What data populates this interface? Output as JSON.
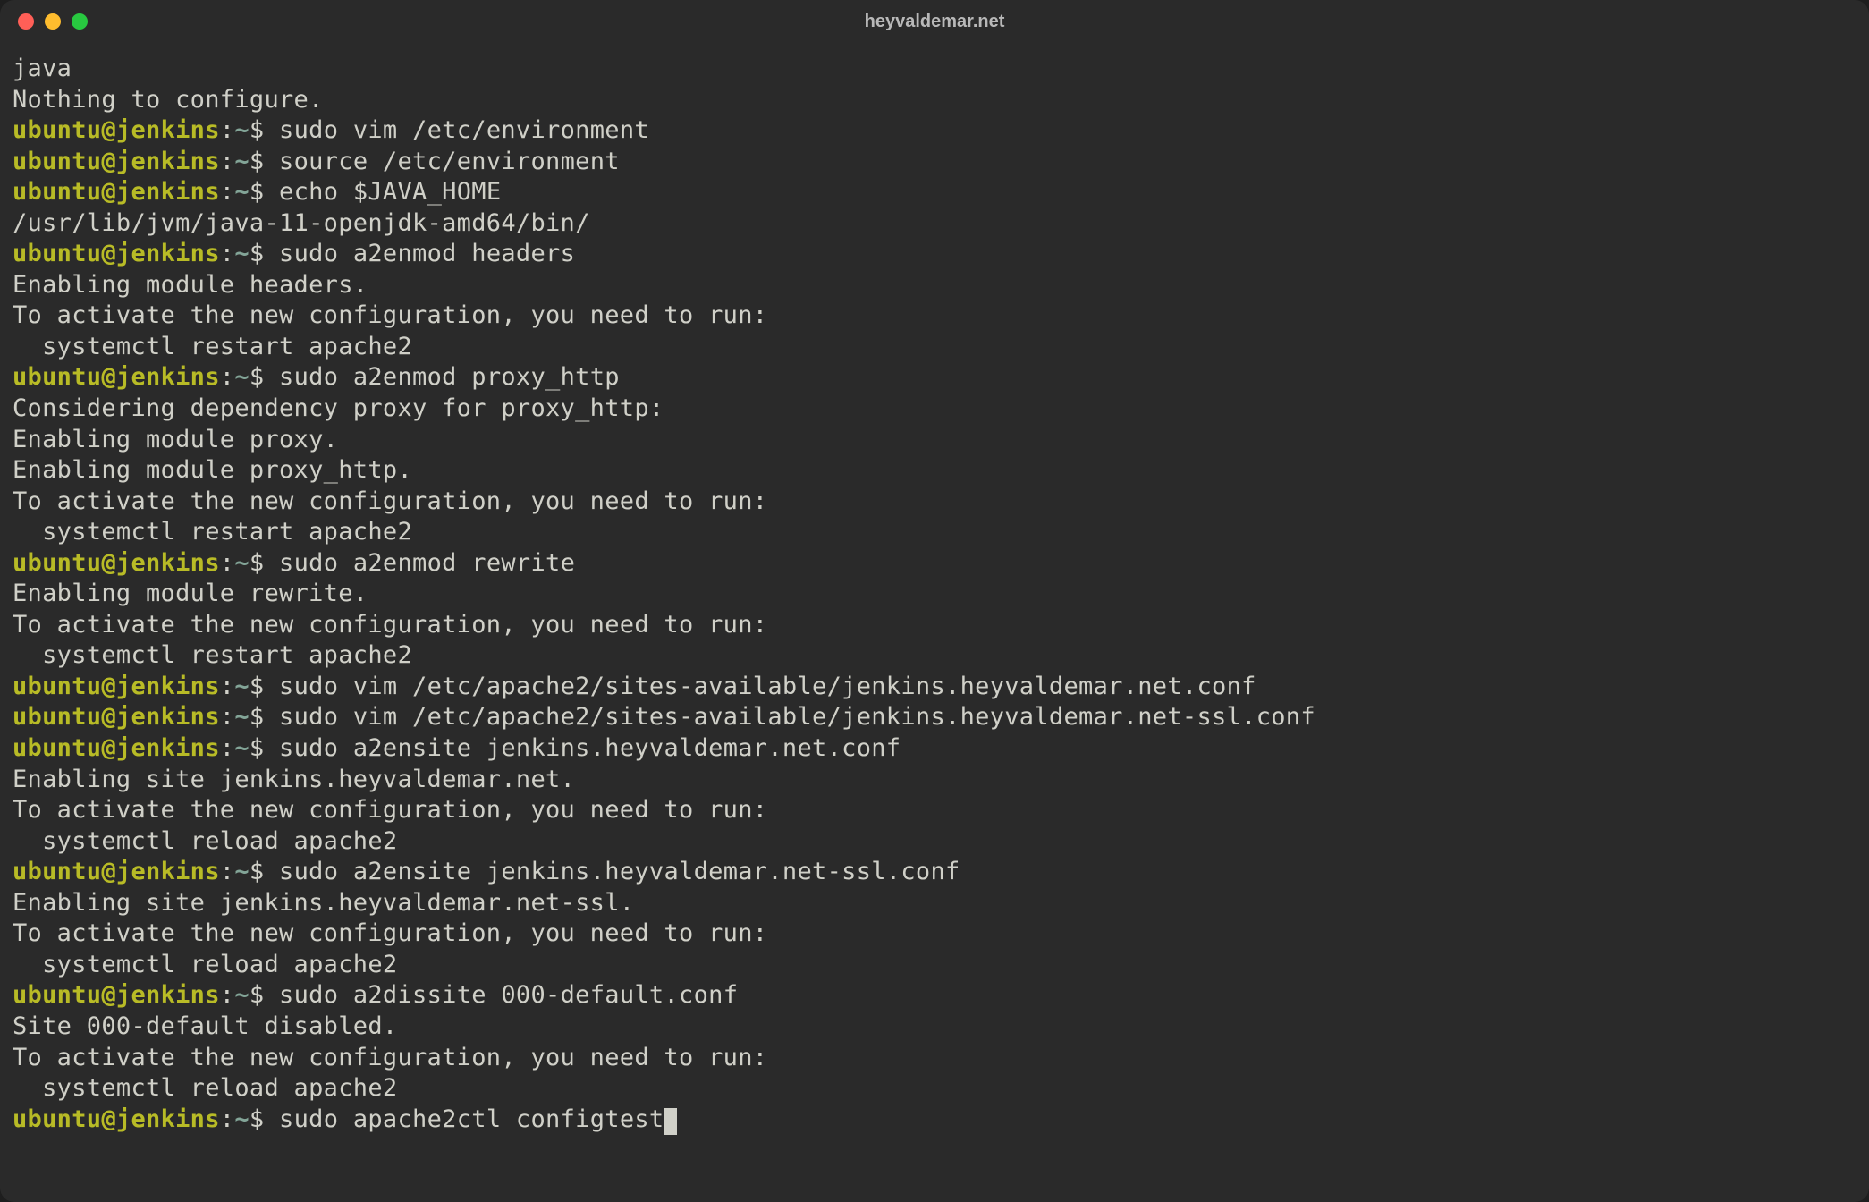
{
  "window": {
    "title": "heyvaldemar.net"
  },
  "prompt": {
    "user": "ubuntu",
    "host": "jenkins",
    "path": "~",
    "symbol": "$"
  },
  "lines": [
    {
      "type": "output",
      "text": "java"
    },
    {
      "type": "output",
      "text": "Nothing to configure."
    },
    {
      "type": "prompt",
      "command": "sudo vim /etc/environment"
    },
    {
      "type": "prompt",
      "command": "source /etc/environment"
    },
    {
      "type": "prompt",
      "command": "echo $JAVA_HOME"
    },
    {
      "type": "output",
      "text": "/usr/lib/jvm/java-11-openjdk-amd64/bin/"
    },
    {
      "type": "prompt",
      "command": "sudo a2enmod headers"
    },
    {
      "type": "output",
      "text": "Enabling module headers."
    },
    {
      "type": "output",
      "text": "To activate the new configuration, you need to run:"
    },
    {
      "type": "output",
      "text": "  systemctl restart apache2"
    },
    {
      "type": "prompt",
      "command": "sudo a2enmod proxy_http"
    },
    {
      "type": "output",
      "text": "Considering dependency proxy for proxy_http:"
    },
    {
      "type": "output",
      "text": "Enabling module proxy."
    },
    {
      "type": "output",
      "text": "Enabling module proxy_http."
    },
    {
      "type": "output",
      "text": "To activate the new configuration, you need to run:"
    },
    {
      "type": "output",
      "text": "  systemctl restart apache2"
    },
    {
      "type": "prompt",
      "command": "sudo a2enmod rewrite"
    },
    {
      "type": "output",
      "text": "Enabling module rewrite."
    },
    {
      "type": "output",
      "text": "To activate the new configuration, you need to run:"
    },
    {
      "type": "output",
      "text": "  systemctl restart apache2"
    },
    {
      "type": "prompt",
      "command": "sudo vim /etc/apache2/sites-available/jenkins.heyvaldemar.net.conf"
    },
    {
      "type": "prompt",
      "command": "sudo vim /etc/apache2/sites-available/jenkins.heyvaldemar.net-ssl.conf"
    },
    {
      "type": "prompt",
      "command": "sudo a2ensite jenkins.heyvaldemar.net.conf"
    },
    {
      "type": "output",
      "text": "Enabling site jenkins.heyvaldemar.net."
    },
    {
      "type": "output",
      "text": "To activate the new configuration, you need to run:"
    },
    {
      "type": "output",
      "text": "  systemctl reload apache2"
    },
    {
      "type": "prompt",
      "command": "sudo a2ensite jenkins.heyvaldemar.net-ssl.conf"
    },
    {
      "type": "output",
      "text": "Enabling site jenkins.heyvaldemar.net-ssl."
    },
    {
      "type": "output",
      "text": "To activate the new configuration, you need to run:"
    },
    {
      "type": "output",
      "text": "  systemctl reload apache2"
    },
    {
      "type": "prompt",
      "command": "sudo a2dissite 000-default.conf"
    },
    {
      "type": "output",
      "text": "Site 000-default disabled."
    },
    {
      "type": "output",
      "text": "To activate the new configuration, you need to run:"
    },
    {
      "type": "output",
      "text": "  systemctl reload apache2"
    },
    {
      "type": "prompt",
      "command": "sudo apache2ctl configtest",
      "cursor": true
    }
  ]
}
